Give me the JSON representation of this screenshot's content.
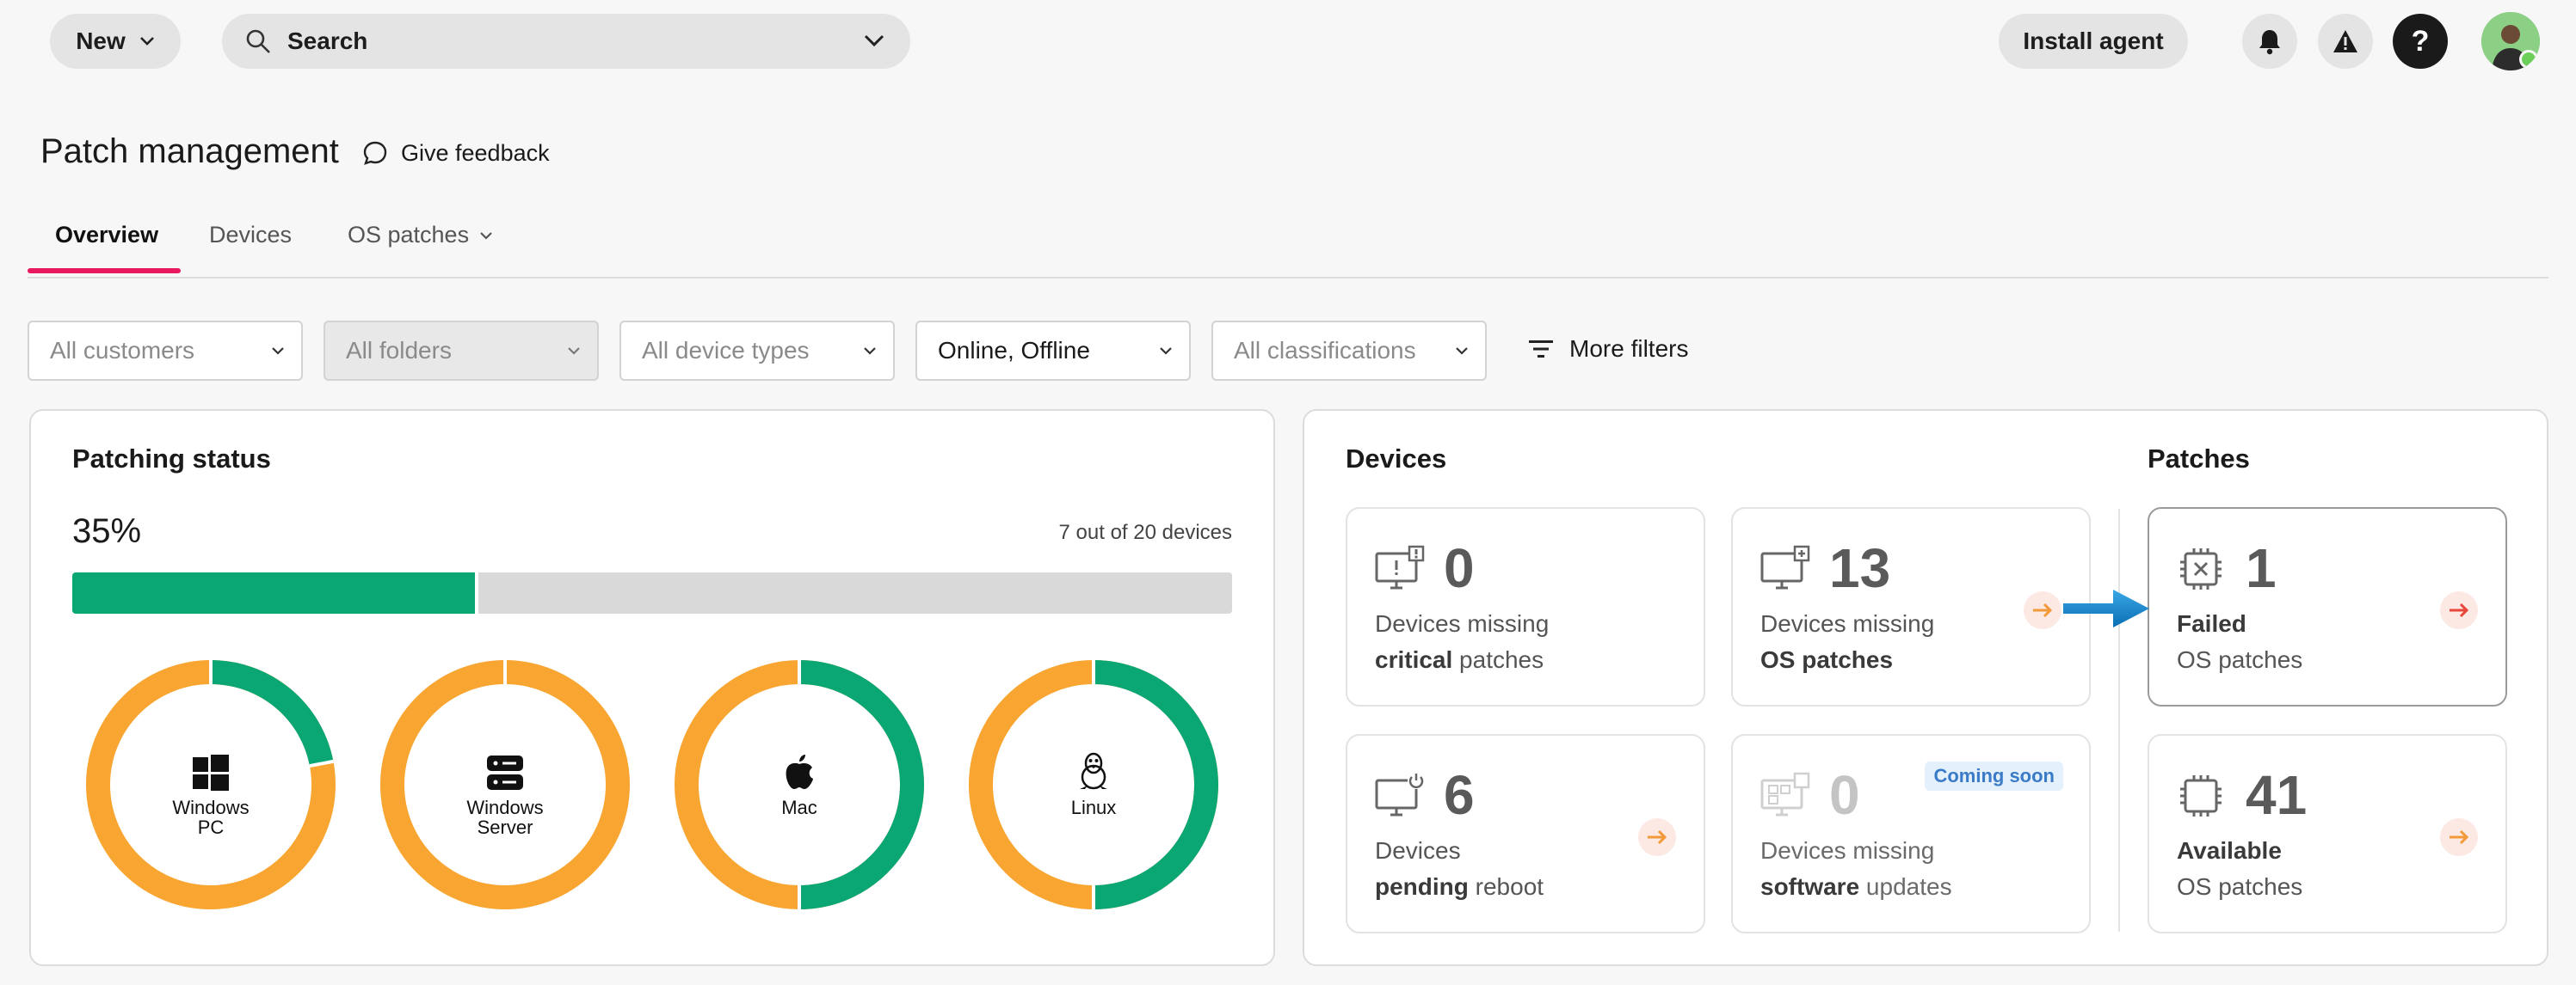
{
  "topbar": {
    "new_label": "New",
    "search_label": "Search",
    "install_label": "Install agent",
    "help_label": "?"
  },
  "page": {
    "title": "Patch management",
    "feedback_label": "Give feedback"
  },
  "tabs": [
    {
      "label": "Overview",
      "active": true
    },
    {
      "label": "Devices",
      "active": false
    },
    {
      "label": "OS patches",
      "active": false
    }
  ],
  "filters": {
    "customers": "All customers",
    "folders": "All folders",
    "device_types": "All device types",
    "status": "Online, Offline",
    "classifications": "All classifications",
    "more_filters": "More filters"
  },
  "patching_status": {
    "title": "Patching status",
    "percent_label": "35%",
    "percent_value": 35,
    "device_count_label": "7 out of 20 devices",
    "colors": {
      "patched": "#0aa774",
      "unpatched": "#f8a531",
      "track": "#d9d9d9"
    },
    "donuts": [
      {
        "label_line1": "Windows",
        "label_line2": "PC",
        "icon": "windows-icon",
        "patched_fraction": 0.22
      },
      {
        "label_line1": "Windows",
        "label_line2": "Server",
        "icon": "server-icon",
        "patched_fraction": 0.0
      },
      {
        "label_line1": "Mac",
        "label_line2": "",
        "icon": "apple-icon",
        "patched_fraction": 0.5
      },
      {
        "label_line1": "Linux",
        "label_line2": "",
        "icon": "linux-icon",
        "patched_fraction": 0.5
      }
    ]
  },
  "devices_section": {
    "title": "Devices",
    "cards": [
      {
        "count": "0",
        "line1": "Devices missing",
        "line2_bold": "critical",
        "line2_rest": " patches",
        "icon": "monitor-alert-icon"
      },
      {
        "count": "13",
        "line1": "Devices missing",
        "line2_bold": "OS patches",
        "line2_rest": "",
        "icon": "monitor-update-icon"
      },
      {
        "count": "6",
        "line1": "Devices",
        "line2_bold": "pending",
        "line2_rest": " reboot",
        "icon": "monitor-power-icon"
      },
      {
        "count": "0",
        "line1": "Devices missing",
        "line2_bold": "software",
        "line2_rest": " updates",
        "icon": "apps-icon",
        "badge": "Coming soon"
      }
    ]
  },
  "patches_section": {
    "title": "Patches",
    "cards": [
      {
        "count": "1",
        "line1_bold": "Failed",
        "line2": "OS patches",
        "icon": "chip-failed-icon"
      },
      {
        "count": "41",
        "line1_bold": "Available",
        "line2": "OS patches",
        "icon": "chip-icon"
      }
    ]
  }
}
